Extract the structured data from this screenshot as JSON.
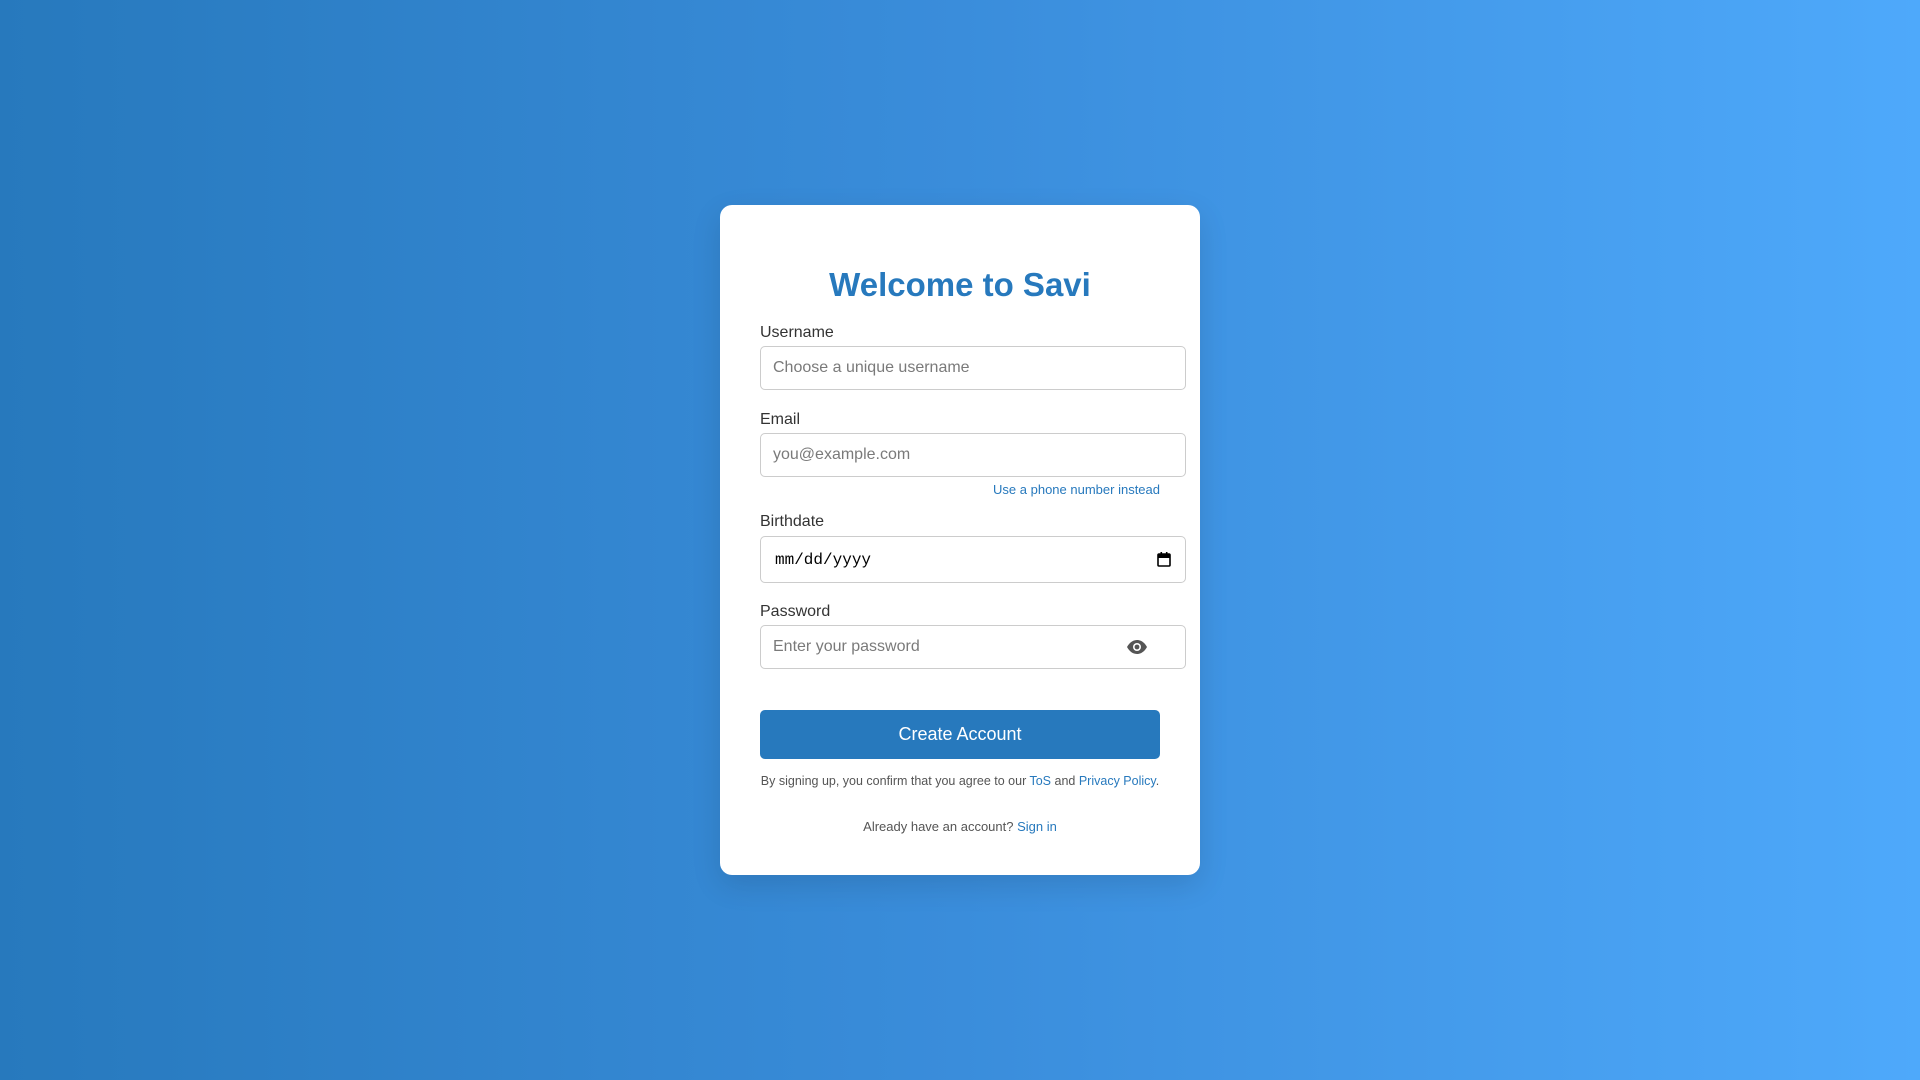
{
  "page": {
    "background_colors": [
      "#2779bd",
      "#4ea9fb"
    ],
    "accent_color": "#2779bd"
  },
  "form": {
    "title": "Welcome to Savi",
    "username": {
      "label": "Username",
      "placeholder": "Choose a unique username",
      "value": ""
    },
    "email": {
      "label": "Email",
      "placeholder": "you@example.com",
      "value": "",
      "alt_link": "Use a phone number instead"
    },
    "birthdate": {
      "label": "Birthdate",
      "placeholder": "mm/dd/yyyy",
      "icon": "calendar-icon"
    },
    "password": {
      "label": "Password",
      "placeholder": "Enter your password",
      "value": "",
      "icon": "eye-icon"
    },
    "submit_label": "Create Account",
    "legal": {
      "prefix": "By signing up, you confirm that you agree to our ",
      "tos_link": "ToS",
      "middle": " and ",
      "privacy_link": "Privacy Policy",
      "suffix": "."
    },
    "signin": {
      "prefix": "Already have an account? ",
      "link": "Sign in"
    }
  }
}
